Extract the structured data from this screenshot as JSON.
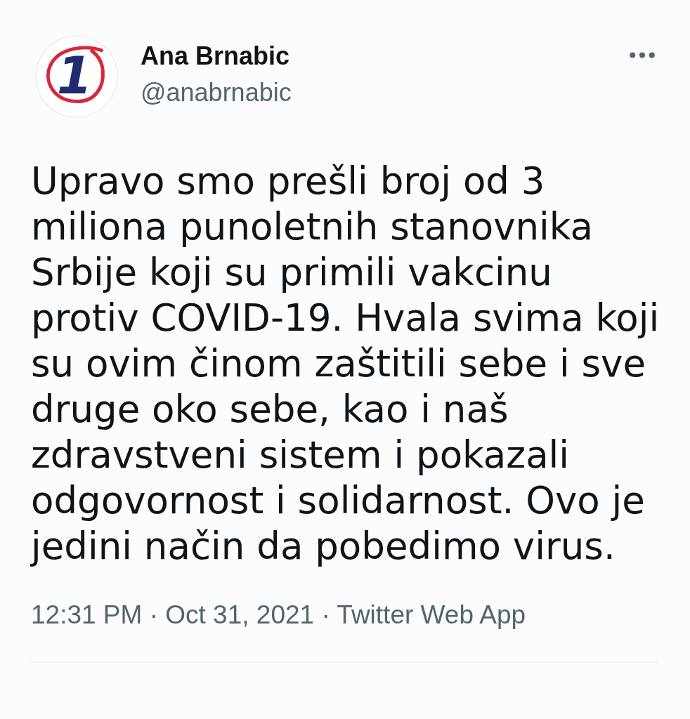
{
  "tweet": {
    "author": {
      "name": "Ana Brnabic",
      "handle": "@anabrnabic",
      "avatar": {
        "logo_text": "1"
      }
    },
    "text": "Upravo smo prešli broj od 3 miliona punoletnih stanovnika Srbije koji su primili vakcinu protiv COVID-19. Hvala svima koji su ovim činom zaštitili sebe i sve druge oko sebe, kao i naš zdravstveni sistem i pokazali odgovornost i solidarnost. Ovo je jedini način da pobedimo virus.",
    "meta": "12:31 PM · Oct 31, 2021 · Twitter Web App"
  }
}
